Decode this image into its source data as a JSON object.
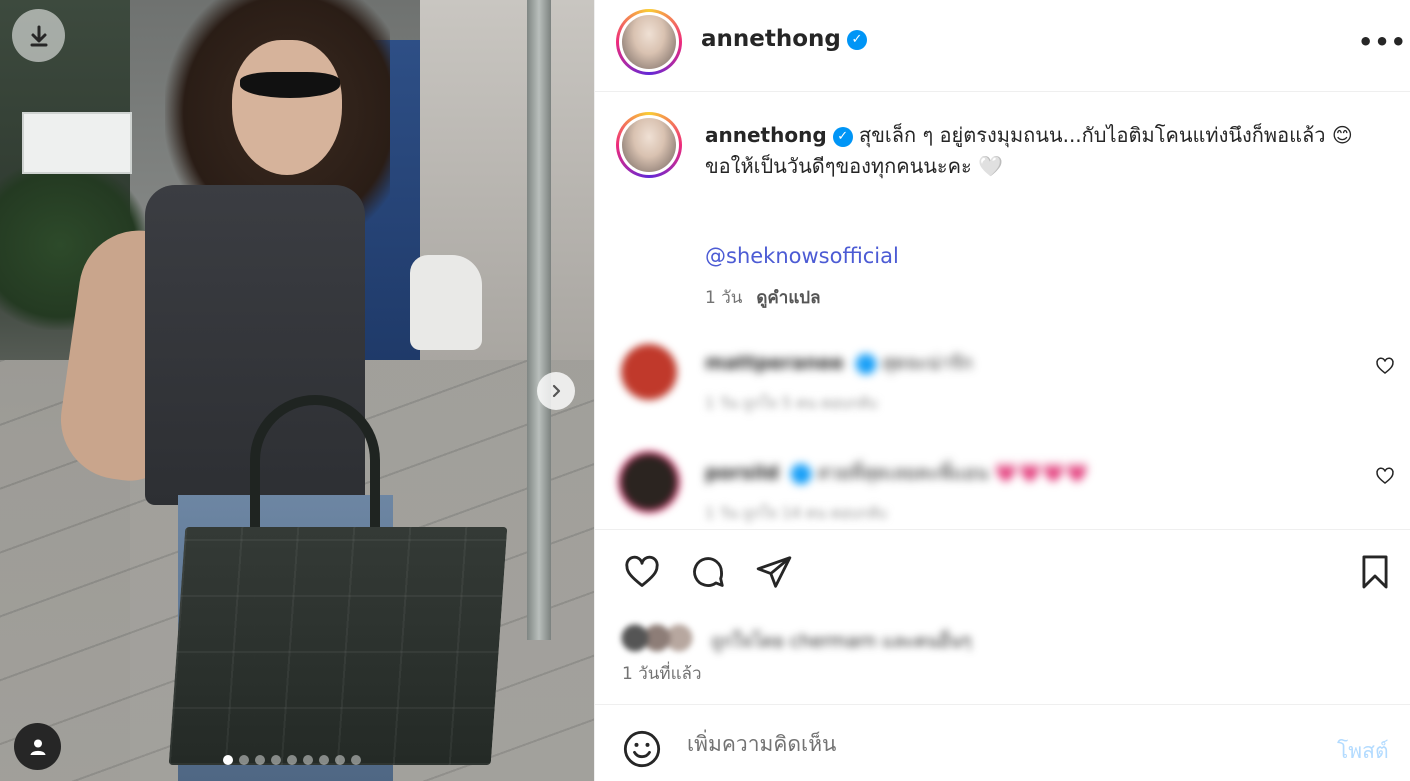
{
  "post": {
    "username": "annethong",
    "verified": true,
    "more_label": "•••"
  },
  "caption": {
    "username": "annethong",
    "line1": "สุขเล็ก ๆ อยู่ตรงมุมถนน...กับไอติมโคนแท่งนึงก็พอแล้ว 😊",
    "line2": "ขอให้เป็นวันดีๆของทุกคนนะคะ 🤍",
    "mention": "@sheknowsofficial",
    "age": "1 วัน",
    "translate": "ดูคำแปล"
  },
  "comments": [
    {
      "username": "mattperanee",
      "text": "สุดจะน่ารัก",
      "meta": "1 วัน   ถูกใจ 5 คน   ตอบกลับ",
      "avatar_color": "#c0392b"
    },
    {
      "username": "porsild",
      "text": "สวยที่สุดเลยคะพี่แอน 💗💗💗💗",
      "meta": "1 วัน   ถูกใจ 14 คน   ตอบกลับ",
      "avatar_color": "#2b2420"
    }
  ],
  "likes": {
    "text": "ถูกใจโดย chermarn และคนอื่นๆ"
  },
  "time_ago": "1 วันที่แล้ว",
  "composer": {
    "placeholder": "เพิ่มความคิดเห็น",
    "post_label": "โพสต์"
  },
  "carousel": {
    "total": 9,
    "active_index": 0
  },
  "icons": {
    "download": "download-icon",
    "next": "chevron-right-icon",
    "tagged_users": "user-icon",
    "like": "heart-icon",
    "comment": "comment-icon",
    "share": "send-icon",
    "save": "bookmark-icon",
    "emoji": "emoji-icon"
  },
  "colors": {
    "mention": "#4c5bd4",
    "verified": "#0095f6",
    "post_disabled": "#b3dbff"
  }
}
